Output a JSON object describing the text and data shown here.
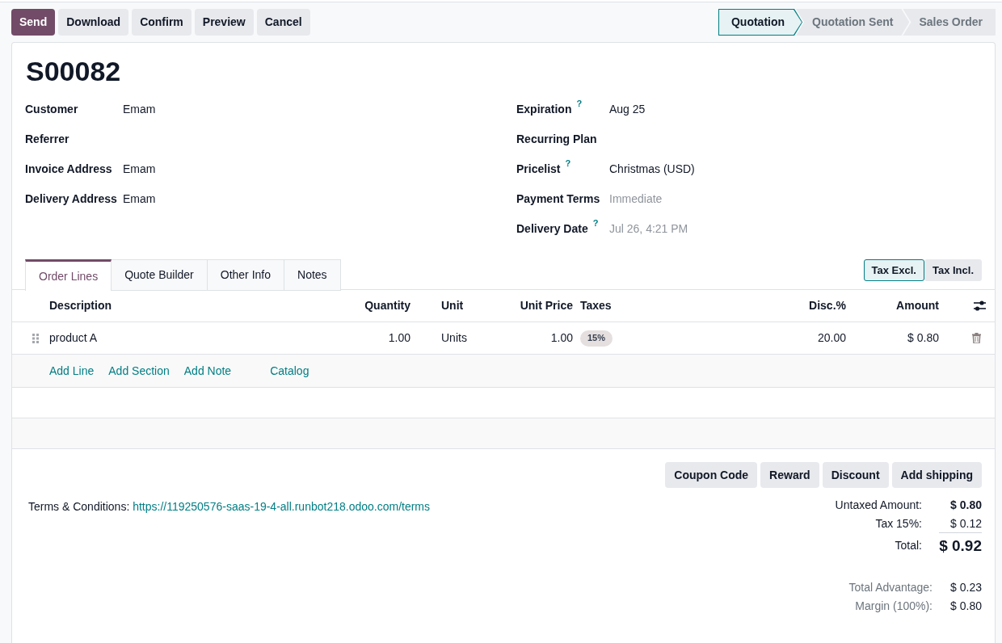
{
  "action_buttons": [
    {
      "label": "Send",
      "kind": "primary"
    },
    {
      "label": "Download",
      "kind": "secondary"
    },
    {
      "label": "Confirm",
      "kind": "secondary"
    },
    {
      "label": "Preview",
      "kind": "secondary"
    },
    {
      "label": "Cancel",
      "kind": "secondary"
    }
  ],
  "status_steps": [
    {
      "label": "Quotation",
      "selected": true
    },
    {
      "label": "Quotation Sent",
      "selected": false
    },
    {
      "label": "Sales Order",
      "selected": false
    }
  ],
  "record": {
    "title": "S00082",
    "fields_left": [
      {
        "label": "Customer",
        "value": "Emam"
      },
      {
        "label": "Referrer"
      },
      {
        "label": "Invoice Address",
        "value": "Emam"
      },
      {
        "label": "Delivery Address",
        "value": "Emam"
      }
    ],
    "fields_right": [
      {
        "label": "Expiration",
        "help": "?",
        "value": "Aug 25"
      },
      {
        "label": "Recurring Plan"
      },
      {
        "label": "Pricelist",
        "help": "?",
        "value": "Christmas (USD)"
      },
      {
        "label": "Payment Terms",
        "placeholder": "Immediate"
      },
      {
        "label": "Delivery Date",
        "help": "?",
        "placeholder": "Jul 26, 4:21 PM"
      }
    ]
  },
  "tabs": [
    {
      "label": "Order Lines",
      "selected": true
    },
    {
      "label": "Quote Builder",
      "selected": false
    },
    {
      "label": "Other Info",
      "selected": false
    },
    {
      "label": "Notes",
      "selected": false
    }
  ],
  "tax_display": [
    {
      "label": "Tax Excl.",
      "selected": true
    },
    {
      "label": "Tax Incl.",
      "selected": false
    }
  ],
  "order_lines": {
    "columns": [
      "Description",
      "Quantity",
      "Unit",
      "Unit Price",
      "Taxes",
      "Disc.%",
      "Amount"
    ],
    "rows": [
      {
        "product": "product A",
        "quantity": "1.00",
        "unit": "Units",
        "unit_price": "1.00",
        "taxes": [
          "15%"
        ],
        "discount": "20.00",
        "amount": "$ 0.80"
      }
    ],
    "add_links": [
      {
        "label": "Add Line",
        "kind": "line"
      },
      {
        "label": "Add Section",
        "kind": "line"
      },
      {
        "label": "Add Note",
        "kind": "line"
      },
      {
        "label": "Catalog",
        "kind": "catalog"
      }
    ]
  },
  "promotion_buttons": [
    "Coupon Code",
    "Reward",
    "Discount",
    "Add shipping"
  ],
  "terms": {
    "label": "Terms & Conditions:",
    "link": "https://119250576-saas-19-4-all.runbot218.odoo.com/terms"
  },
  "totals": [
    {
      "label": "Untaxed Amount:",
      "value": "$ 0.80",
      "kind": "subtotal"
    },
    {
      "label": "Tax 15%:",
      "value": "$ 0.12",
      "kind": "tax"
    },
    {
      "label": "Total:",
      "value": "$ 0.92",
      "kind": "total"
    }
  ],
  "margin_info": [
    {
      "label": "Total Advantage:",
      "value": "$ 0.23"
    },
    {
      "label": "Margin (100%):",
      "value": "$ 0.80"
    }
  ]
}
